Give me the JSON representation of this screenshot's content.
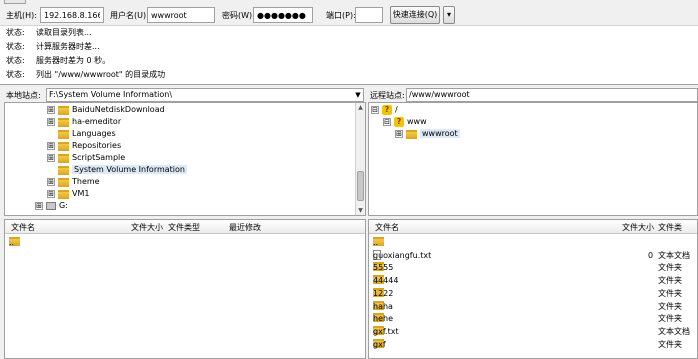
{
  "quickconnect": {
    "host_label": "主机(H):",
    "host_value": "192.168.8.166",
    "user_label": "用户名(U):",
    "user_value": "wwwroot",
    "pass_label": "密码(W):",
    "pass_value": "●●●●●●●",
    "port_label": "端口(P):",
    "port_value": "",
    "connect_label": "快速连接(Q)",
    "dropdown_glyph": "▾"
  },
  "log": [
    {
      "key": "状态:",
      "msg": "读取目录列表..."
    },
    {
      "key": "状态:",
      "msg": "计算服务器时差..."
    },
    {
      "key": "状态:",
      "msg": "服务器时差为 0 秒。"
    },
    {
      "key": "状态:",
      "msg": "列出 \"/www/wwwroot\" 的目录成功"
    }
  ],
  "local": {
    "site_label": "本地站点:",
    "path": "F:\\System Volume Information\\",
    "tree": [
      {
        "name": "BaiduNetdiskDownload",
        "expander": "⊞"
      },
      {
        "name": "ha-emeditor",
        "expander": "⊞"
      },
      {
        "name": "Languages",
        "expander": ""
      },
      {
        "name": "Repositories",
        "expander": "⊞"
      },
      {
        "name": "ScriptSample",
        "expander": "⊞"
      },
      {
        "name": "System Volume Information",
        "expander": "",
        "selected": true
      },
      {
        "name": "Theme",
        "expander": "⊞"
      },
      {
        "name": "VM1",
        "expander": "⊞"
      },
      {
        "name": "G:",
        "expander": "⊞",
        "drive": true
      }
    ],
    "columns": [
      "文件名",
      "文件大小",
      "文件类型",
      "最近修改"
    ],
    "files": [
      {
        "name": ".."
      }
    ]
  },
  "remote": {
    "site_label": "远程站点:",
    "path": "/www/wwwroot",
    "tree": [
      {
        "name": "/",
        "expander": "⊟"
      },
      {
        "name": "www",
        "expander": "⊟"
      },
      {
        "name": "wwwroot",
        "expander": "⊞"
      }
    ],
    "columns": [
      "文件名",
      "文件大小",
      "文件类"
    ],
    "files": [
      {
        "name": "..",
        "size": "",
        "type": "",
        "kind": "folder"
      },
      {
        "name": "guoxiangfu.txt",
        "size": "0",
        "type": "文本文档",
        "kind": "file"
      },
      {
        "name": "5555",
        "size": "",
        "type": "文件夹",
        "kind": "folder"
      },
      {
        "name": "44444",
        "size": "",
        "type": "文件夹",
        "kind": "folder"
      },
      {
        "name": "1222",
        "size": "",
        "type": "文件夹",
        "kind": "folder"
      },
      {
        "name": "haha",
        "size": "",
        "type": "文件夹",
        "kind": "folder"
      },
      {
        "name": "hehe",
        "size": "",
        "type": "文件夹",
        "kind": "folder"
      },
      {
        "name": "gxf.txt",
        "size": "",
        "type": "文本文档",
        "kind": "folder"
      },
      {
        "name": "gxf",
        "size": "",
        "type": "文件夹",
        "kind": "folder"
      }
    ]
  },
  "colors": {
    "folder": "#f2c94c",
    "folder_dark": "#d9a520",
    "selection": "#dde9f7"
  }
}
